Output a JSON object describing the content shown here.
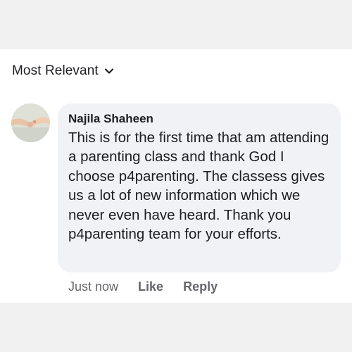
{
  "sort": {
    "label": "Most Relevant",
    "icon": "chevron-down-icon"
  },
  "comment": {
    "author": "Najila Shaheen",
    "avatar_icon": "avatar-hands-photo",
    "text": "This is for the first time that am attending a parenting class and thank God I choose p4parenting. The classess gives us a lot of new information which we never even have heard. Thank you p4parenting team for your efforts.",
    "timestamp": "Just now",
    "like_label": "Like",
    "reply_label": "Reply"
  },
  "colors": {
    "bubble": "#f0f2f5",
    "text": "#1c1e21",
    "secondary": "#65676b",
    "page_background": "#f0f0f0"
  }
}
